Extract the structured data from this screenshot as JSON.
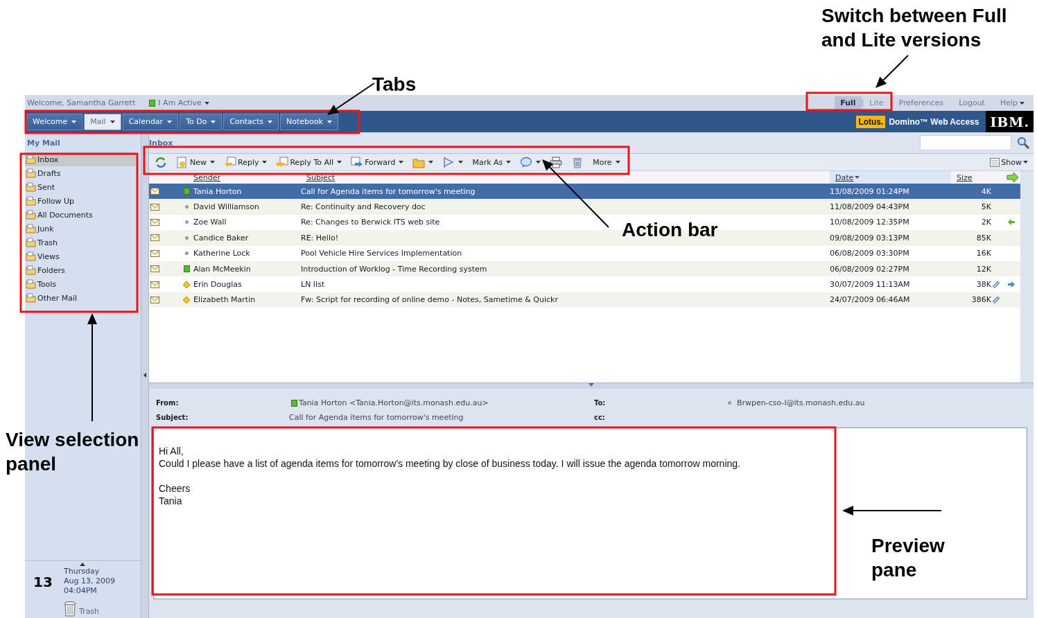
{
  "top_bar": {
    "welcome": "Welcome, Samantha Garrett",
    "status": {
      "label": "I Am Active",
      "kind": "online"
    },
    "version_switch": [
      {
        "label": "Full",
        "selected": true
      },
      {
        "label": "Lite",
        "selected": false
      }
    ],
    "separator": "|",
    "links": [
      {
        "label": "Preferences",
        "dropdown": false
      },
      {
        "label": "Logout",
        "dropdown": false
      },
      {
        "label": "Help",
        "dropdown": true
      }
    ]
  },
  "tabs": [
    {
      "label": "Welcome",
      "selected": false
    },
    {
      "label": "Mail",
      "selected": true
    },
    {
      "label": "Calendar",
      "selected": false
    },
    {
      "label": "To Do",
      "selected": false
    },
    {
      "label": "Contacts",
      "selected": false
    },
    {
      "label": "Notebook",
      "selected": false
    }
  ],
  "brand": {
    "lotus": "Lotus.",
    "product": "Domino™ Web Access",
    "ibm": "IBM."
  },
  "sidebar": {
    "title": "My Mail",
    "items": [
      {
        "label": "Inbox",
        "selected": true
      },
      {
        "label": "Drafts",
        "selected": false
      },
      {
        "label": "Sent",
        "selected": false
      },
      {
        "label": "Follow Up",
        "selected": false
      },
      {
        "label": "All Documents",
        "selected": false
      },
      {
        "label": "Junk",
        "selected": false
      },
      {
        "label": "Trash",
        "selected": false
      },
      {
        "label": "Views",
        "selected": false
      },
      {
        "label": "Folders",
        "selected": false
      },
      {
        "label": "Tools",
        "selected": false
      },
      {
        "label": "Other Mail",
        "selected": false
      }
    ]
  },
  "calendar_widget": {
    "day": "13",
    "weekday": "Thursday",
    "date": "Aug 13, 2009",
    "time": "04:04PM",
    "trash": "Trash"
  },
  "inbox": {
    "title": "Inbox",
    "show": "Show"
  },
  "toolbar": [
    {
      "kind": "refresh",
      "dropdown": false
    },
    {
      "kind": "new",
      "label": "New",
      "dropdown": true
    },
    {
      "kind": "reply",
      "label": "Reply",
      "dropdown": true
    },
    {
      "kind": "reply_all",
      "label": "Reply To All",
      "dropdown": true
    },
    {
      "kind": "forward",
      "label": "Forward",
      "dropdown": true
    },
    {
      "kind": "folder",
      "dropdown": true
    },
    {
      "kind": "flag",
      "dropdown": true
    },
    {
      "kind": "text",
      "label": "Mark As",
      "dropdown": true
    },
    {
      "kind": "chat",
      "dropdown": true
    },
    {
      "kind": "print",
      "dropdown": false
    },
    {
      "kind": "delete",
      "dropdown": false
    },
    {
      "kind": "text",
      "label": "More",
      "dropdown": true
    }
  ],
  "columns": [
    {
      "label": "Sender",
      "sorted": false
    },
    {
      "label": "Subject",
      "sorted": false
    },
    {
      "label": "Date",
      "sorted": true
    },
    {
      "label": "Size",
      "sorted": false
    }
  ],
  "messages": [
    {
      "sender": "Tania Horton",
      "status": {
        "kind": "online"
      },
      "subject": "Call for Agenda items for tomorrow's meeting",
      "date": "13/08/2009 01:24PM",
      "size": "4K",
      "attachment": false,
      "replied": false,
      "forwarded": false,
      "selected": true
    },
    {
      "sender": "David Williamson",
      "status": {
        "kind": "offline"
      },
      "subject": "Re: Continuity and Recovery doc",
      "date": "11/08/2009 04:43PM",
      "size": "5K",
      "attachment": false,
      "replied": false,
      "forwarded": false,
      "selected": false
    },
    {
      "sender": "Zoe Wall",
      "status": {
        "kind": "offline"
      },
      "subject": "Re: Changes to Berwick ITS web site",
      "date": "10/08/2009 12:35PM",
      "size": "2K",
      "attachment": false,
      "replied": true,
      "forwarded": false,
      "selected": false
    },
    {
      "sender": "Candice Baker",
      "status": {
        "kind": "offline"
      },
      "subject": "RE: Hello!",
      "date": "09/08/2009 03:13PM",
      "size": "85K",
      "attachment": false,
      "replied": false,
      "forwarded": false,
      "selected": false
    },
    {
      "sender": "Katherine Lock",
      "status": {
        "kind": "offline"
      },
      "subject": "Pool Vehicle Hire Services Implementation",
      "date": "06/08/2009 03:30PM",
      "size": "16K",
      "attachment": false,
      "replied": false,
      "forwarded": false,
      "selected": false
    },
    {
      "sender": "Alan McMeekin",
      "status": {
        "kind": "online"
      },
      "subject": "Introduction of  Worklog - Time Recording system",
      "date": "06/08/2009 02:27PM",
      "size": "12K",
      "attachment": false,
      "replied": false,
      "forwarded": false,
      "selected": false
    },
    {
      "sender": "Erin Douglas",
      "status": {
        "kind": "away"
      },
      "subject": "LN list",
      "date": "30/07/2009 11:13AM",
      "size": "38K",
      "attachment": true,
      "replied": false,
      "forwarded": true,
      "selected": false
    },
    {
      "sender": "Elizabeth Martin",
      "status": {
        "kind": "away"
      },
      "subject": "Fw: Script for recording of online demo - Notes, Sametime & Quickr",
      "date": "24/07/2009 06:46AM",
      "size": "386K",
      "attachment": true,
      "replied": false,
      "forwarded": false,
      "selected": false
    }
  ],
  "preview": {
    "from_label": "From:",
    "from": "Tania Horton <Tania.Horton@its.monash.edu.au>",
    "from_status": {
      "kind": "online"
    },
    "to_label": "To:",
    "to": "Brwpen-cso-l@its.monash.edu.au",
    "to_status": {
      "kind": "offline"
    },
    "subject_label": "Subject:",
    "subject": "Call for Agenda items for tomorrow's meeting",
    "cc_label": "cc:",
    "paragraphs": [
      [
        "Hi All,",
        "Could I please have a list of agenda items for tomorrow's meeting by close of business today.  I will issue the agenda tomorrow morning."
      ],
      [
        "Cheers",
        "Tania"
      ]
    ]
  },
  "annotations": [
    {
      "kind": "version",
      "text": "Switch between Full and Lite versions"
    },
    {
      "kind": "tabs",
      "text": "Tabs"
    },
    {
      "kind": "actions",
      "text": "Action bar"
    },
    {
      "kind": "sidebar",
      "text": "View selection panel"
    },
    {
      "kind": "preview",
      "text": "Preview pane"
    }
  ]
}
